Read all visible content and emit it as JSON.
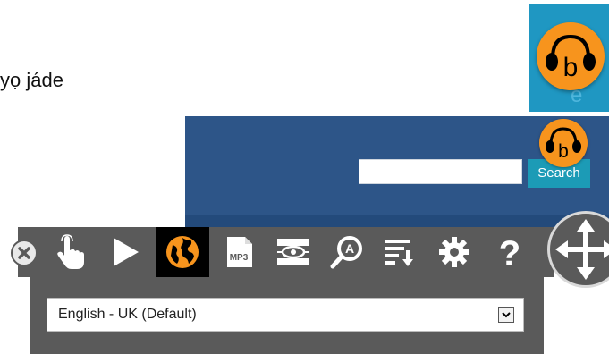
{
  "page": {
    "cutoff_text": "yọ jáde"
  },
  "header": {
    "search": {
      "value": "",
      "placeholder": "",
      "button_label": "Search"
    }
  },
  "logo": {
    "letter": "b",
    "ghost_text": "e"
  },
  "toolbar": {
    "buttons": [
      {
        "name": "click-to-speak",
        "icon": "hand-pointer-icon",
        "active": false
      },
      {
        "name": "play",
        "icon": "play-icon",
        "active": false
      },
      {
        "name": "translate",
        "icon": "globe-icon",
        "active": true
      },
      {
        "name": "mp3",
        "icon": "mp3-file-icon",
        "label": "MP3",
        "active": false
      },
      {
        "name": "screen-mask",
        "icon": "screen-mask-icon",
        "active": false
      },
      {
        "name": "magnifier",
        "icon": "magnifier-icon",
        "active": false
      },
      {
        "name": "text-mode",
        "icon": "text-list-icon",
        "active": false
      },
      {
        "name": "settings",
        "icon": "gear-icon",
        "active": false
      },
      {
        "name": "help",
        "icon": "question-icon",
        "label": "?",
        "active": false
      }
    ],
    "colors": {
      "bar": "#5a5a5a",
      "active": "#000000",
      "accent": "#f7941d",
      "icon": "#ffffff"
    }
  },
  "language_panel": {
    "selected": "English - UK (Default)"
  },
  "colors": {
    "header_blue": "#2d5588",
    "search_button": "#1c9bb6",
    "logo_orange": "#f7941d"
  }
}
